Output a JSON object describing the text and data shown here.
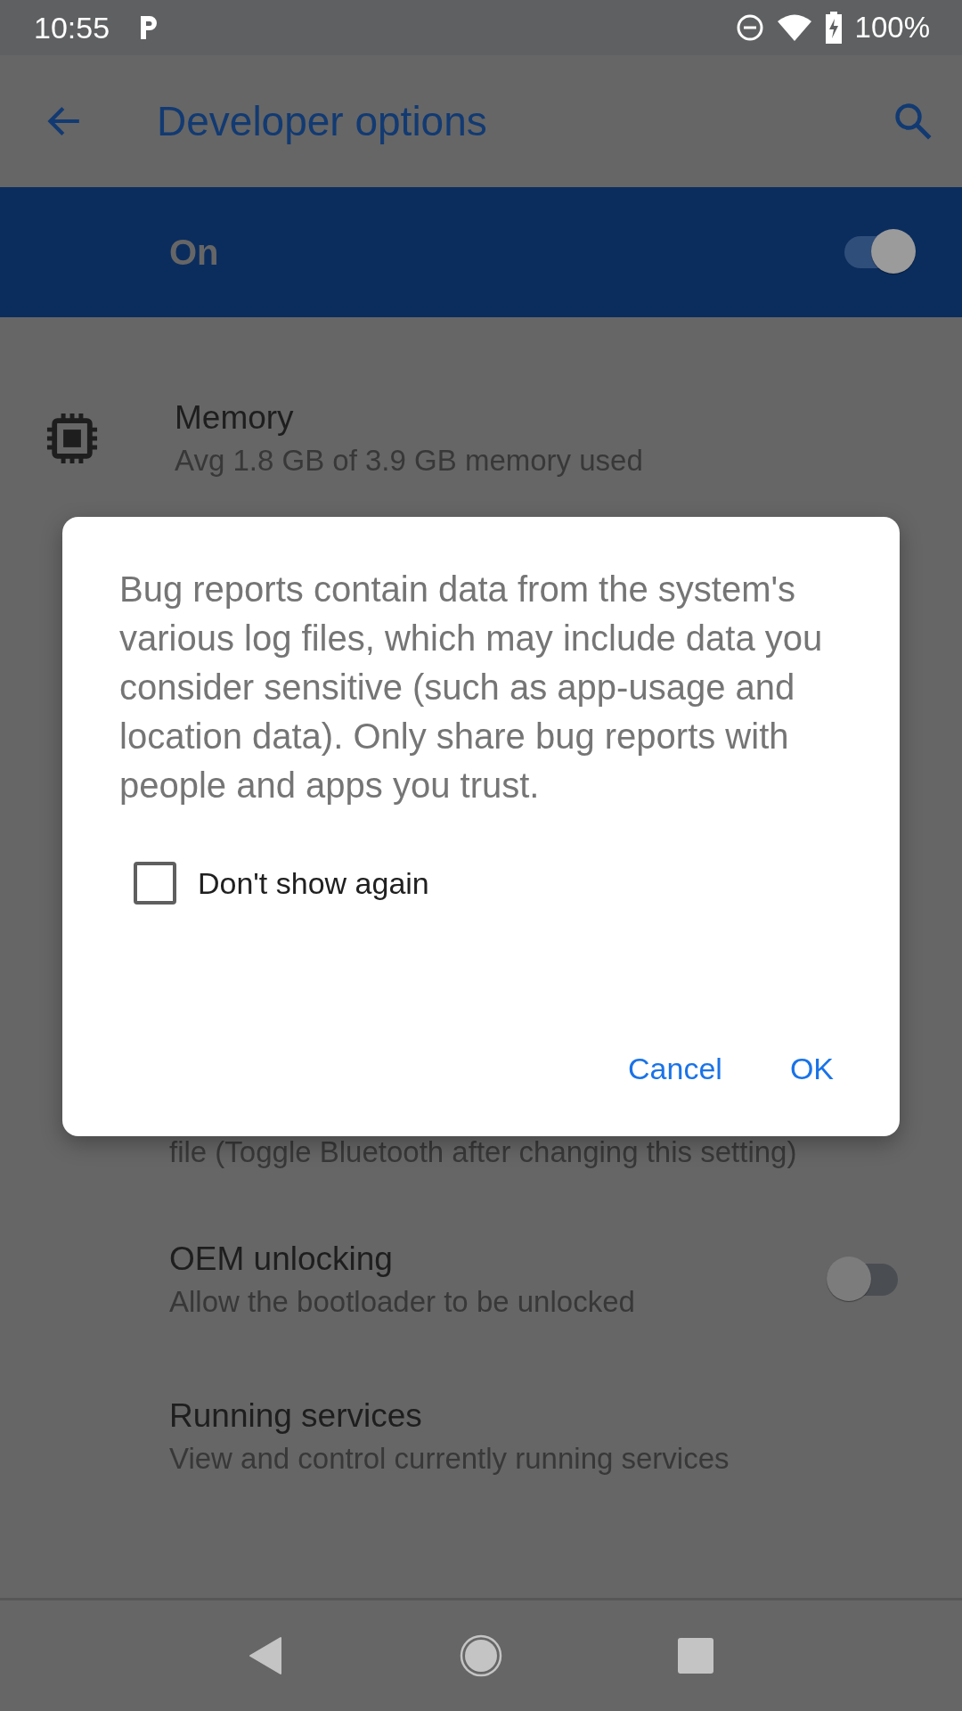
{
  "status_bar": {
    "time": "10:55",
    "battery": "100%"
  },
  "app_bar": {
    "title": "Developer options"
  },
  "master_switch": {
    "label": "On",
    "on": true
  },
  "settings": [
    {
      "kind": "icon",
      "title": "Memory",
      "subtitle": "Avg 1.8 GB of 3.9 GB memory used"
    },
    {
      "kind": "partial",
      "subtitle": "file (Toggle Bluetooth after changing this setting)"
    },
    {
      "kind": "switch",
      "title": "OEM unlocking",
      "subtitle": "Allow the bootloader to be unlocked",
      "on": false
    },
    {
      "kind": "plain",
      "title": "Running services",
      "subtitle": "View and control currently running services"
    }
  ],
  "dialog": {
    "message": "Bug reports contain data from the system's various log files, which may include data you consider sensitive (such as app-usage and location data). Only share bug reports with people and apps you trust.",
    "checkbox": {
      "label": "Don't show again",
      "checked": false
    },
    "buttons": [
      "Cancel",
      "OK"
    ]
  }
}
